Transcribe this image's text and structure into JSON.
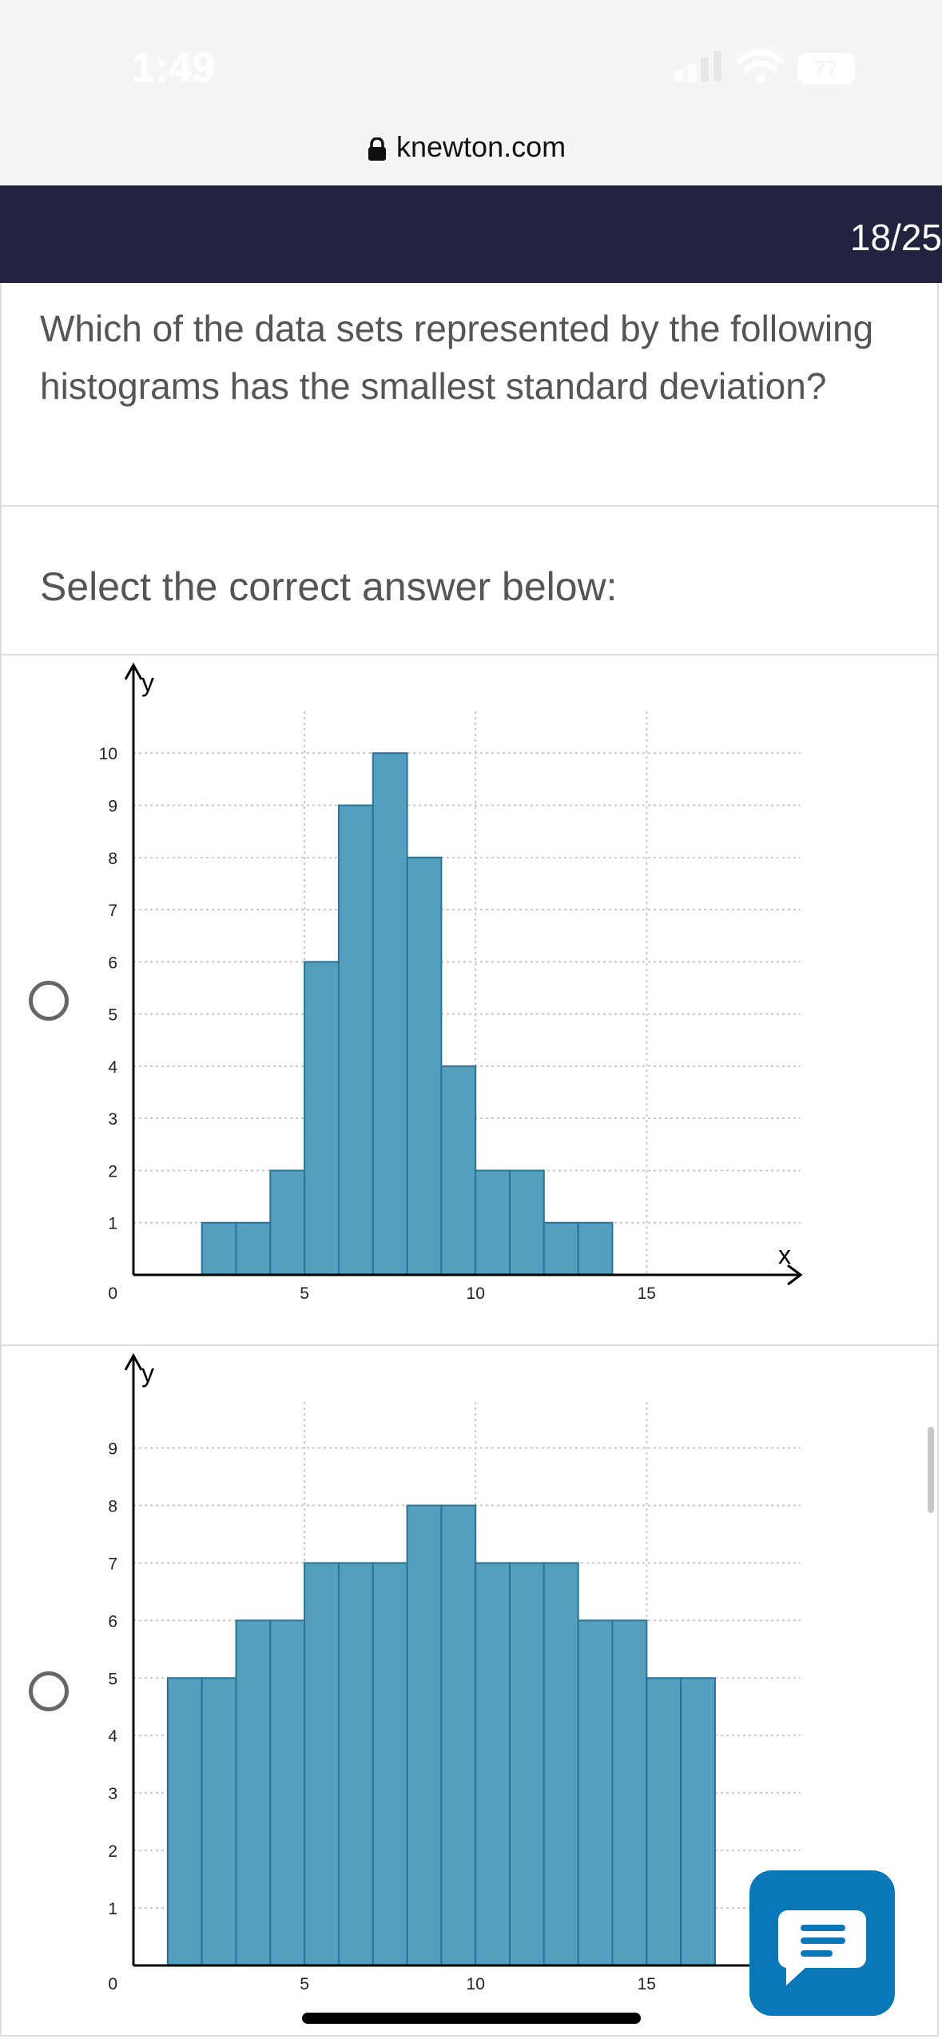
{
  "status_bar": {
    "time": "1:49",
    "battery": "77"
  },
  "browser": {
    "url": "knewton.com"
  },
  "header": {
    "progress": "18/25"
  },
  "question": {
    "text": "Which of the data sets represented by the following histograms has the smallest standard deviation?",
    "instruction": "Select the correct answer below:"
  },
  "colors": {
    "bar_fill": "#549fbd",
    "bar_stroke": "#2a7397",
    "header_bg": "#22233f",
    "chat_button": "#0a78b8"
  },
  "icons": [
    "lock-icon",
    "signal-icon",
    "wifi-icon",
    "battery-icon",
    "radio-button",
    "chat-icon"
  ],
  "chart_data": [
    {
      "type": "bar",
      "title": "",
      "xlabel": "x",
      "ylabel": "y",
      "bin_width": 1,
      "x_start": 0,
      "bin_starts": [
        0,
        1,
        2,
        3,
        4,
        5,
        6,
        7,
        8,
        9,
        10,
        11,
        12,
        13,
        14,
        15
      ],
      "values": [
        0,
        0,
        1,
        1,
        2,
        6,
        9,
        10,
        8,
        4,
        2,
        2,
        1,
        1,
        0,
        0
      ],
      "xlim": [
        0,
        19.5
      ],
      "ylim": [
        0,
        10.8
      ],
      "x_ticks": [
        "0",
        "5",
        "10",
        "15"
      ],
      "x_tick_values": [
        0,
        5,
        10,
        15
      ],
      "y_ticks": [
        "1",
        "2",
        "3",
        "4",
        "5",
        "6",
        "7",
        "8",
        "9",
        "10"
      ],
      "grid": true,
      "x_arrow": true
    },
    {
      "type": "bar",
      "title": "",
      "xlabel": "",
      "ylabel": "y",
      "bin_width": 1,
      "x_start": 0,
      "bin_starts": [
        0,
        1,
        2,
        3,
        4,
        5,
        6,
        7,
        8,
        9,
        10,
        11,
        12,
        13,
        14,
        15
      ],
      "values": [
        0,
        5,
        5,
        6,
        6,
        7,
        7,
        7,
        8,
        8,
        7,
        7,
        7,
        6,
        6,
        5,
        5
      ],
      "xlim": [
        0,
        19.5
      ],
      "ylim": [
        0,
        9.8
      ],
      "x_ticks": [
        "0",
        "5",
        "10",
        "15"
      ],
      "x_tick_values": [
        0,
        5,
        10,
        15
      ],
      "y_ticks": [
        "1",
        "2",
        "3",
        "4",
        "5",
        "6",
        "7",
        "8",
        "9"
      ],
      "grid": true,
      "x_arrow": false
    }
  ]
}
